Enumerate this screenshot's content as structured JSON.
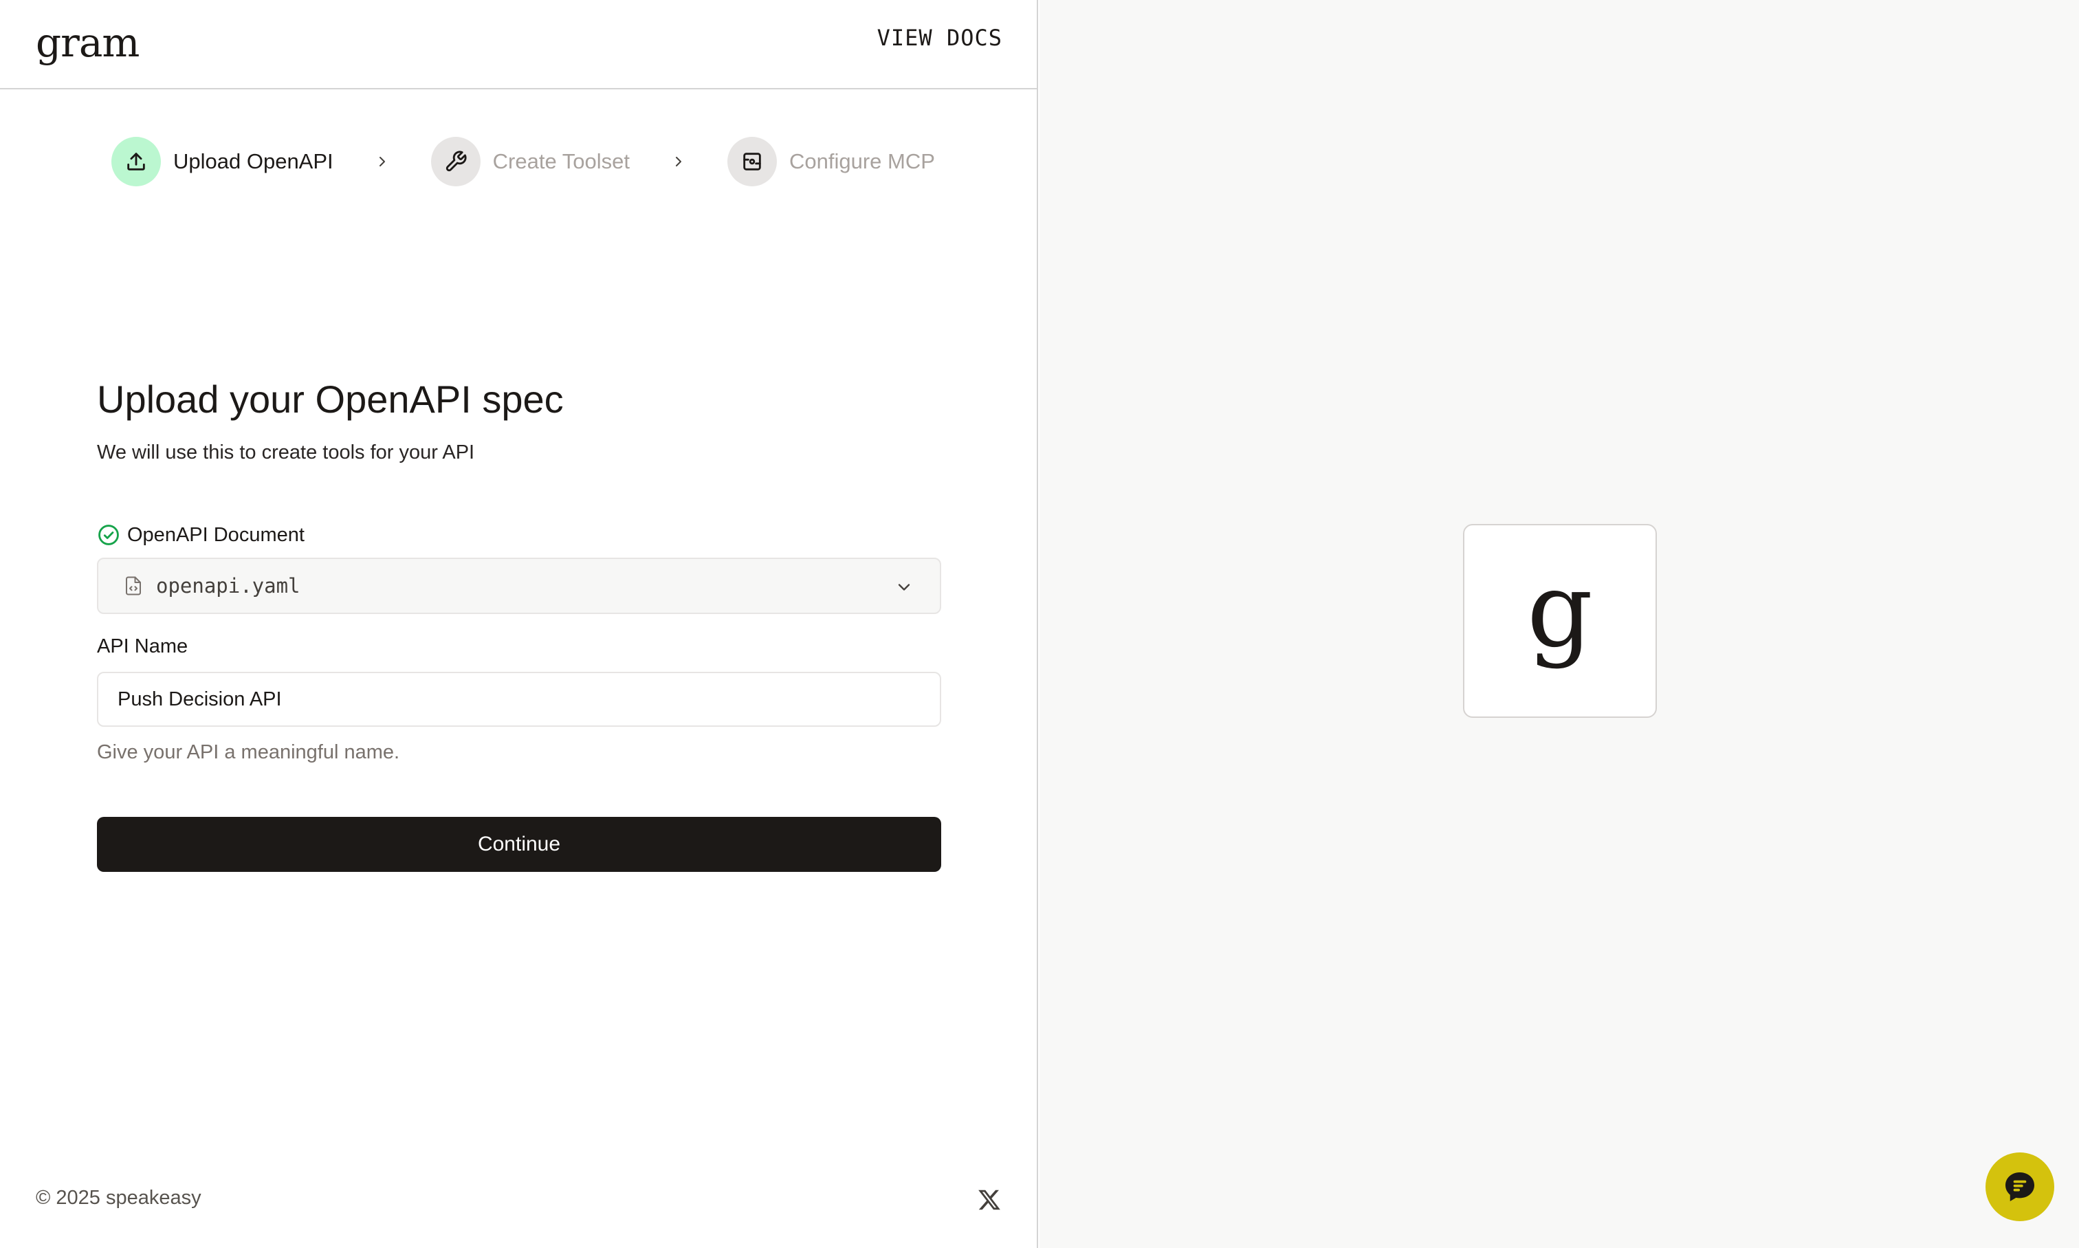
{
  "header": {
    "logo_text": "gram",
    "view_docs_label": "VIEW DOCS"
  },
  "stepper": {
    "steps": [
      {
        "label": "Upload OpenAPI",
        "icon": "upload-icon",
        "state": "active"
      },
      {
        "label": "Create Toolset",
        "icon": "wrench-icon",
        "state": "inactive"
      },
      {
        "label": "Configure MCP",
        "icon": "server-icon",
        "state": "inactive"
      }
    ]
  },
  "form": {
    "title": "Upload your OpenAPI spec",
    "subtitle": "We will use this to create tools for your API",
    "document": {
      "label": "OpenAPI Document",
      "selected_file": "openapi.yaml"
    },
    "api_name": {
      "label": "API Name",
      "value": "Push Decision API",
      "help_text": "Give your API a meaningful name."
    },
    "continue_label": "Continue"
  },
  "footer": {
    "copyright": "© 2025 speakeasy"
  },
  "preview": {
    "logo_glyph": "g"
  },
  "colors": {
    "accent_green": "#bbf7d0",
    "success_green": "#16a34a",
    "primary_button": "#1c1917",
    "chat_bubble": "#d4c20d",
    "right_pane_bg": "#f8f8f7"
  }
}
